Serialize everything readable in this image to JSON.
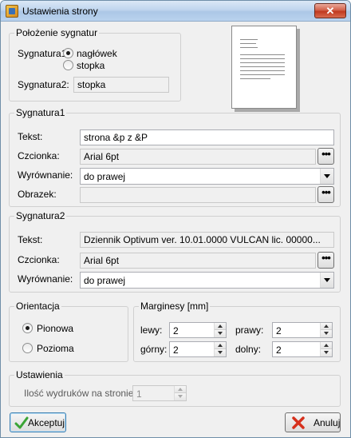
{
  "window": {
    "title": "Ustawienia strony",
    "close_symbol": "✕",
    "icon": "app-icon"
  },
  "position_group": {
    "title": "Położenie sygnatur",
    "sig1_label": "Sygnatura1:",
    "option_header": "nagłówek",
    "option_footer": "stopka",
    "selected": "nagłówek",
    "sig2_label": "Sygnatura2:",
    "sig2_value": "stopka"
  },
  "sig1": {
    "title": "Sygnatura1",
    "text_label": "Tekst:",
    "text_value": "strona &p z &P",
    "font_label": "Czcionka:",
    "font_value": "Arial 6pt",
    "align_label": "Wyrównanie:",
    "align_value": "do prawej",
    "image_label": "Obrazek:",
    "image_value": "",
    "browse_symbol": "•••"
  },
  "sig2": {
    "title": "Sygnatura2",
    "text_label": "Tekst:",
    "text_value": "Dziennik Optivum ver. 10.01.0000 VULCAN lic. 00000...",
    "font_label": "Czcionka:",
    "font_value": "Arial 6pt",
    "align_label": "Wyrównanie:",
    "align_value": "do prawej",
    "browse_symbol": "•••"
  },
  "orientation": {
    "title": "Orientacja",
    "portrait": "Pionowa",
    "landscape": "Pozioma",
    "selected": "Pionowa"
  },
  "margins": {
    "title": "Marginesy [mm]",
    "left_label": "lewy:",
    "left_value": "2",
    "right_label": "prawy:",
    "right_value": "2",
    "top_label": "górny:",
    "top_value": "2",
    "bottom_label": "dolny:",
    "bottom_value": "2"
  },
  "settings": {
    "title": "Ustawienia",
    "copies_label": "Ilość wydruków na stronie:",
    "copies_value": "1"
  },
  "buttons": {
    "accept": "Akceptuj",
    "cancel": "Anuluj"
  },
  "colors": {
    "check_green": "#3aa435",
    "cancel_red": "#d6301c",
    "title_blue": "#bfd5ee"
  }
}
